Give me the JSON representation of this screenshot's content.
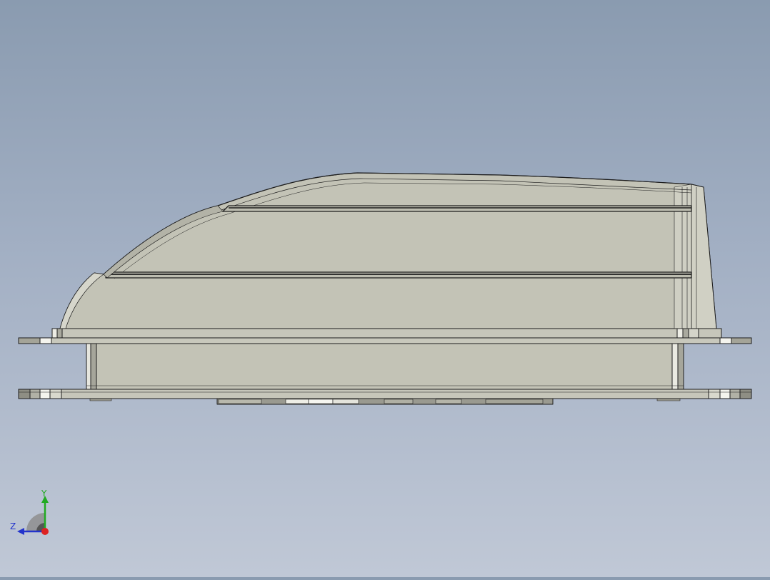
{
  "viewport": {
    "model_description_hidden": "",
    "model_parts": [
      "vent-dome",
      "upper-slat",
      "lower-slat",
      "top-flange",
      "housing-body",
      "base-flange",
      "bottom-grille"
    ]
  },
  "triad": {
    "y_label": "Y",
    "z_label": "Z",
    "y_color": "#22aa22",
    "z_color": "#2233cc",
    "x_color": "#dd2222"
  },
  "colors": {
    "body_fill": "#c3c3b6",
    "body_fill_light": "#cfcfc3",
    "body_fill_dark": "#a9a99c",
    "edge": "#1e1e1e",
    "highlight": "#f2f2ea"
  }
}
